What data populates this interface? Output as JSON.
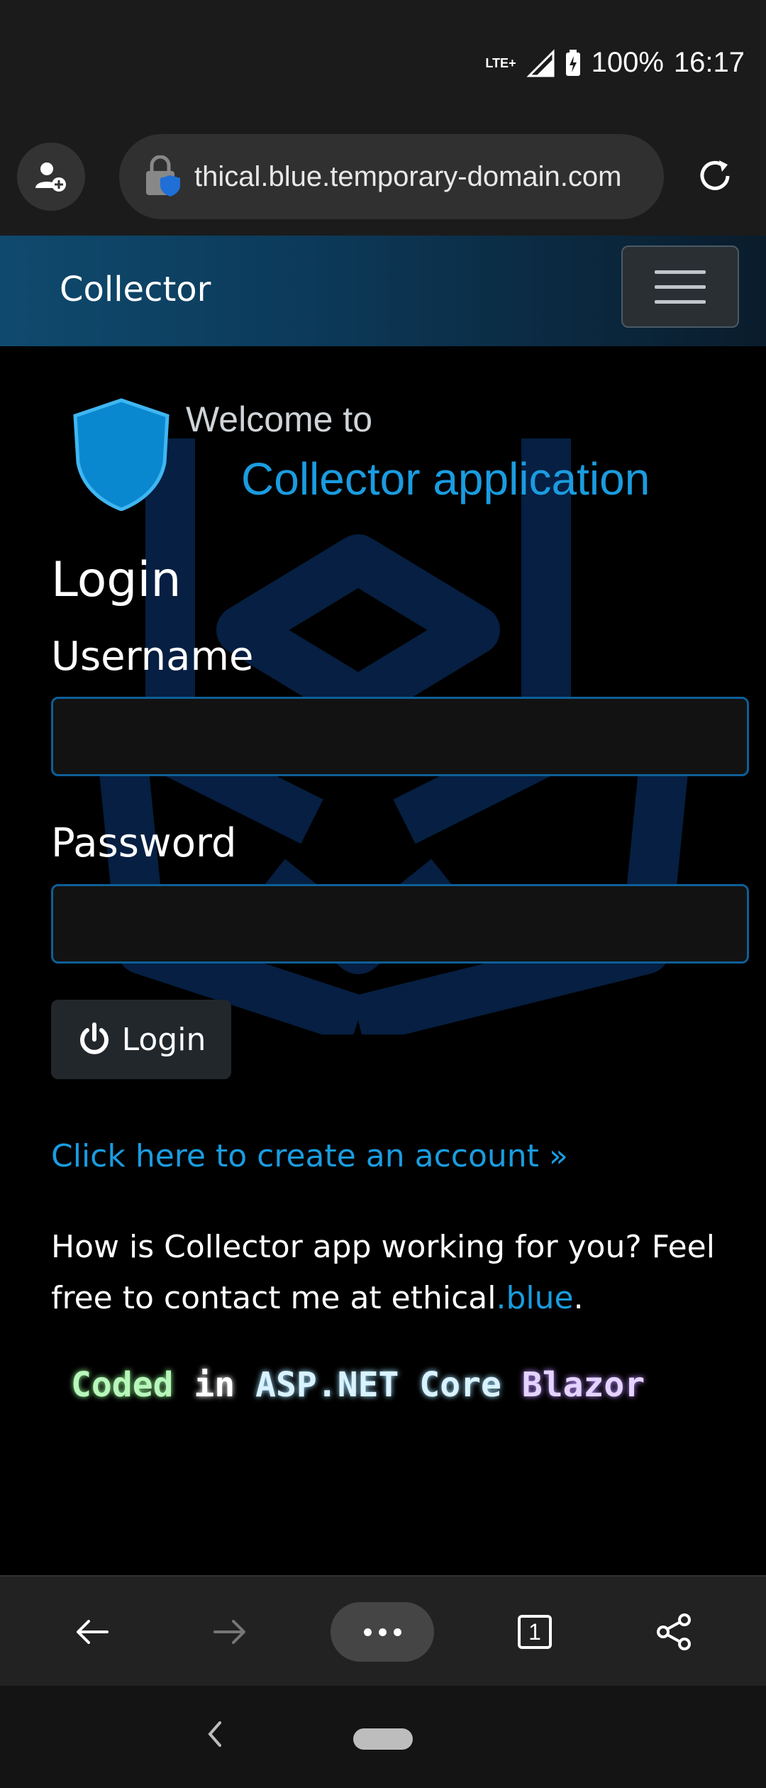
{
  "status_bar": {
    "network": "LTE+",
    "battery": "100%",
    "time": "16:17"
  },
  "browser": {
    "url": "thical.blue.temporary-domain.com",
    "tab_count": "1"
  },
  "navbar": {
    "brand": "Collector"
  },
  "welcome": {
    "line1": "Welcome to",
    "line2": "Collector application"
  },
  "login_form": {
    "title": "Login",
    "username_label": "Username",
    "username_value": "",
    "password_label": "Password",
    "password_value": "",
    "submit_label": "Login"
  },
  "links": {
    "create_account": "Click here to create an account »"
  },
  "feedback": {
    "text_before": "How is Collector app working for you? Feel free to contact me at ethical",
    "link_text": ".blue",
    "text_after": "."
  },
  "footer_badge": {
    "part1": "Coded",
    "part2": "in",
    "part3": "ASP.NET Core",
    "part4": "Blazor"
  },
  "colors": {
    "accent": "#1a9ce0",
    "navbar_start": "#0f4a6e",
    "background": "#000000"
  }
}
